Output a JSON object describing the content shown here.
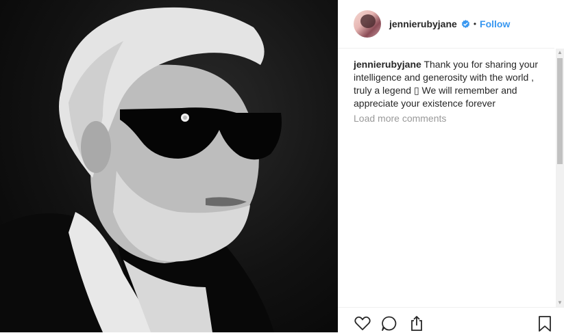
{
  "post": {
    "username": "jennierubyjane",
    "follow_label": "Follow",
    "separator": "•",
    "verified_icon": "verified-badge-icon",
    "accent_color": "#3897f0"
  },
  "comments": [
    {
      "username": "jennierubyjane",
      "text": "Thank you for sharing your intelligence and generosity with the world , truly a legend ▯ We will remember and appreciate your existence forever"
    }
  ],
  "load_more_label": "Load more comments",
  "actions": {
    "like_icon": "heart-icon",
    "comment_icon": "comment-icon",
    "share_icon": "share-icon",
    "save_icon": "bookmark-icon"
  }
}
